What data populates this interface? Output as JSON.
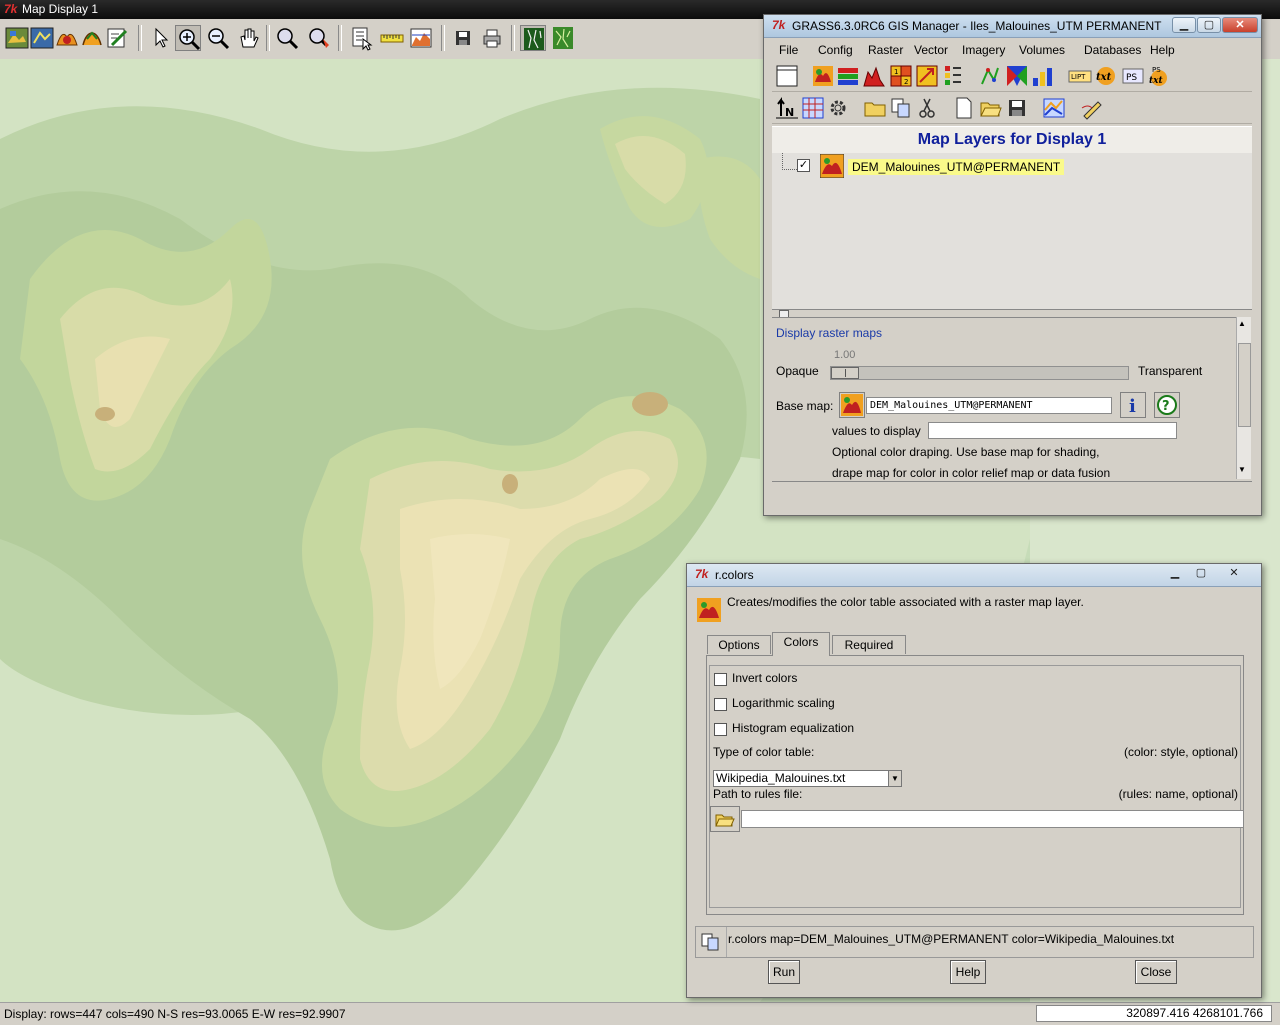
{
  "map_display": {
    "title": "Map Display 1",
    "toolbar_icons": [
      "display-map-icon",
      "redraw-icon",
      "add-raster-icon",
      "add-vector-icon",
      "erase-icon",
      "pointer-icon",
      "zoom-in-icon",
      "zoom-out-icon",
      "pan-icon",
      "zoom-back-icon",
      "zoom-menu-icon",
      "query-icon",
      "measure-icon",
      "profile-icon",
      "save-display-icon",
      "print-icon",
      "2d-view-icon",
      "3d-view-icon"
    ],
    "status_text": "Display: rows=447 cols=490  N-S res=93.0065  E-W res=92.9907",
    "coordinates": "320897.416 4268101.766"
  },
  "gis_manager": {
    "title": "GRASS6.3.0RC6 GIS Manager - Iles_Malouines_UTM PERMANENT",
    "menu": [
      "File",
      "Config",
      "Raster",
      "Vector",
      "Imagery",
      "Volumes",
      "Databases",
      "Help"
    ],
    "layers_header": "Map Layers for Display 1",
    "layers": [
      {
        "name": "DEM_Malouines_UTM@PERMANENT",
        "checked": true
      }
    ],
    "props": {
      "title": "Display raster maps",
      "opaque_label": "Opaque",
      "opacity_value": "1.00",
      "transparent_label": "Transparent",
      "base_map_label": "Base map:",
      "base_map_value": "DEM_Malouines_UTM@PERMANENT",
      "values_label": "values to display",
      "values_value": "",
      "drape_text_1": "Optional color draping. Use base map for shading,",
      "drape_text_2": "drape map for color in color relief map or data fusion"
    }
  },
  "rcolors": {
    "title": "r.colors",
    "description": "Creates/modifies the color table associated with a raster map layer.",
    "tabs": [
      "Options",
      "Colors",
      "Required"
    ],
    "active_tab": "Colors",
    "checkboxes": [
      {
        "label": "Invert colors",
        "checked": false
      },
      {
        "label": "Logarithmic scaling",
        "checked": false
      },
      {
        "label": "Histogram equalization",
        "checked": false
      }
    ],
    "color_table_label": "Type of color table:",
    "color_table_hint": "(color:  style, optional)",
    "color_table_value": "Wikipedia_Malouines.txt",
    "rules_label": "Path to rules file:",
    "rules_hint": "(rules:  name, optional)",
    "rules_value": "",
    "command": "r.colors map=DEM_Malouines_UTM@PERMANENT color=Wikipedia_Malouines.txt",
    "buttons": {
      "run": "Run",
      "help": "Help",
      "close": "Close"
    }
  }
}
